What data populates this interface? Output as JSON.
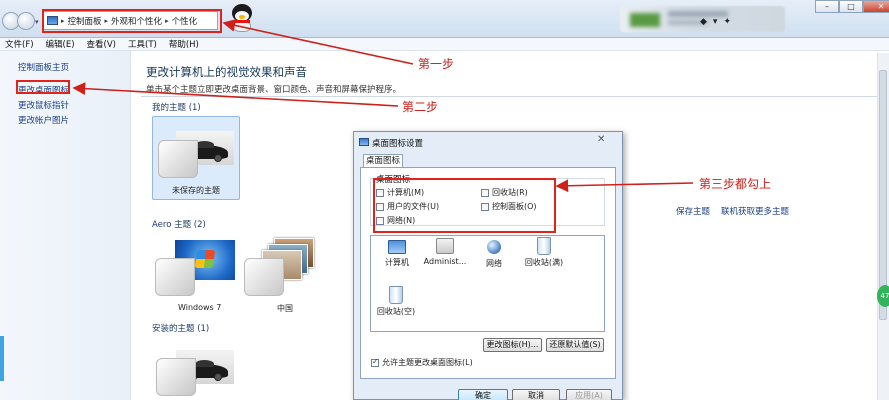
{
  "breadcrumb": [
    "控制面板",
    "外观和个性化",
    "个性化"
  ],
  "menu": [
    "文件(F)",
    "编辑(E)",
    "查看(V)",
    "工具(T)",
    "帮助(H)"
  ],
  "left_pane": {
    "home": "控制面板主页",
    "desktop_icons": "更改桌面图标",
    "mouse_pointers": "更改鼠标指针",
    "account_picture": "更改帐户图片"
  },
  "main": {
    "title": "更改计算机上的视觉效果和声音",
    "subtitle": "单击某个主题立即更改桌面背景、窗口颜色、声音和屏幕保护程序。",
    "my_themes": "我的主题 (1)",
    "unsaved_theme": "未保存的主题",
    "aero_themes": "Aero 主题 (2)",
    "theme_windows7": "Windows 7",
    "theme_china": "中国",
    "installed_themes": "安装的主题 (1)",
    "save_theme": "保存主题",
    "get_more": "联机获取更多主题"
  },
  "dialog": {
    "title": "桌面图标设置",
    "tab": "桌面图标",
    "group_label": "桌面图标",
    "checkboxes": [
      {
        "label": "计算机(M)",
        "checked": false
      },
      {
        "label": "回收站(R)",
        "checked": false
      },
      {
        "label": "用户的文件(U)",
        "checked": false
      },
      {
        "label": "控制面板(O)",
        "checked": false
      },
      {
        "label": "网络(N)",
        "checked": false
      }
    ],
    "icons": [
      "计算机",
      "Administ...",
      "网络",
      "回收站(满)",
      "回收站(空)"
    ],
    "change_icon": "更改图标(H)...",
    "restore_default": "还原默认值(S)",
    "allow_themes": "允许主题更改桌面图标(L)",
    "allow_themes_checked": true,
    "ok": "确定",
    "cancel": "取消",
    "apply": "应用(A)"
  },
  "annotations": {
    "step1": "第一步",
    "step2": "第二步",
    "step3": "第三步都勾上",
    "color": "#d0201a"
  },
  "badge": "47"
}
